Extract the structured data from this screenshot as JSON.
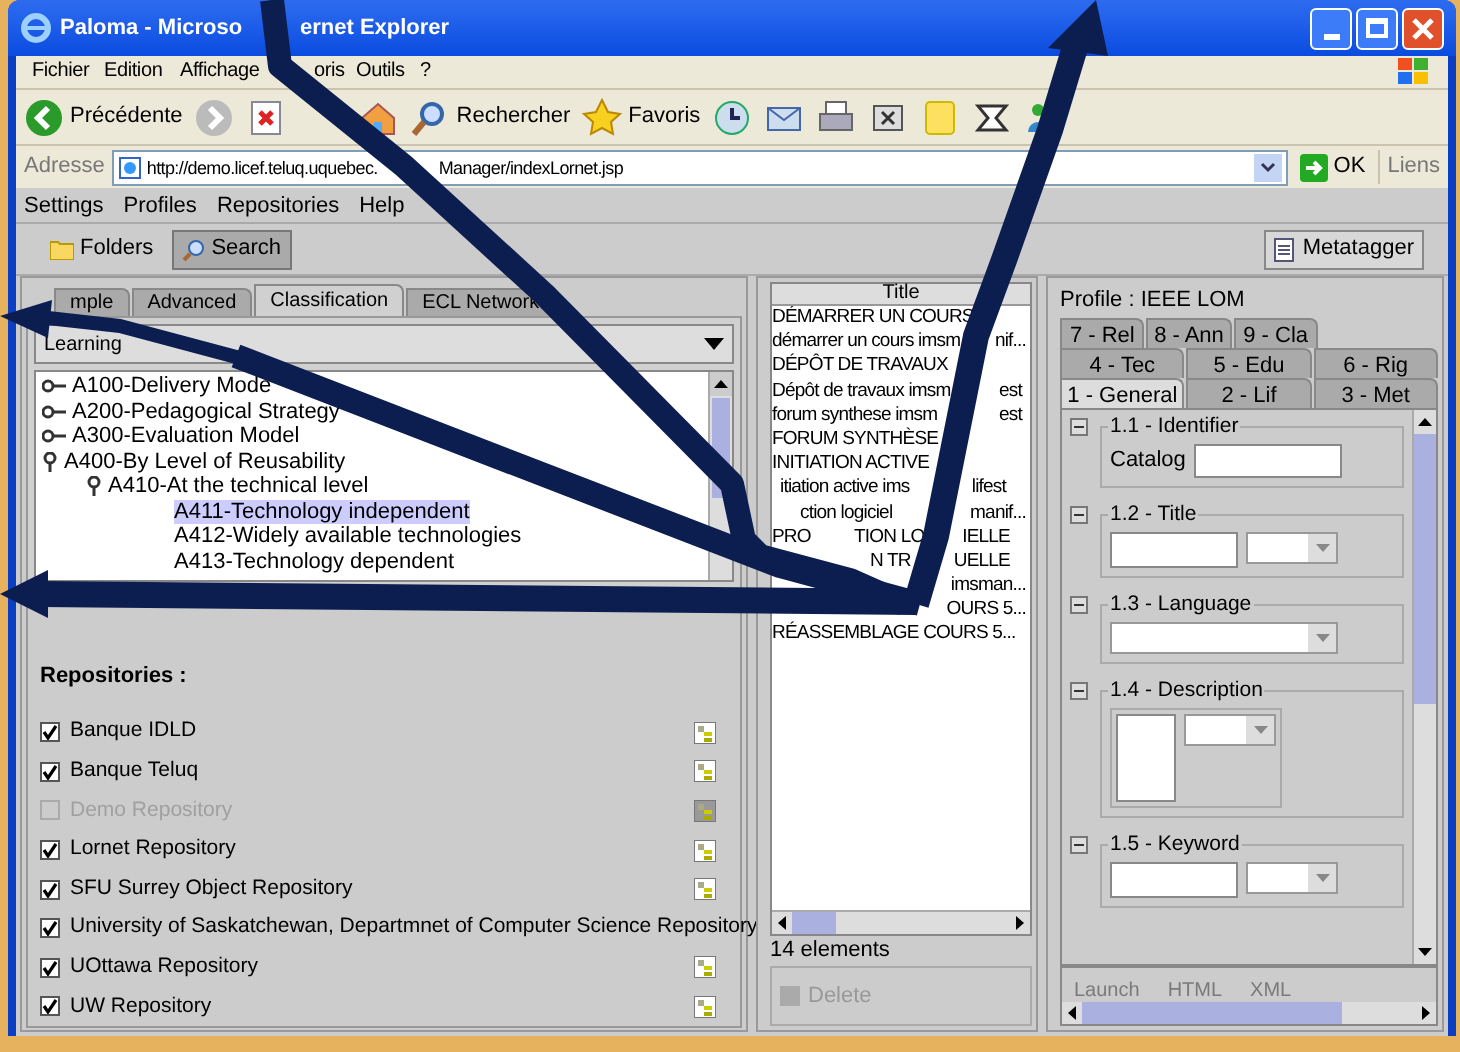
{
  "window": {
    "title_parts": [
      "Paloma - Microso",
      "ernet Explorer"
    ]
  },
  "ie_menu": [
    "Fichier",
    "Edition",
    "Affichage",
    "oris",
    "Outils",
    "?"
  ],
  "ie_toolbar": [
    {
      "kind": "back",
      "label": "Précédente"
    },
    {
      "kind": "forward"
    },
    {
      "kind": "stop"
    },
    {
      "kind": "home"
    },
    {
      "kind": "search",
      "label": "Rechercher"
    },
    {
      "kind": "favorites",
      "label": "Favoris"
    },
    {
      "kind": "history"
    },
    {
      "kind": "mail"
    },
    {
      "kind": "print"
    },
    {
      "kind": "edit"
    },
    {
      "kind": "note"
    },
    {
      "kind": "tool"
    },
    {
      "kind": "people"
    }
  ],
  "address": {
    "label": "Adresse",
    "url_parts": [
      "http://demo.licef.teluq.uquebec.",
      "Manager/indexLornet.jsp"
    ],
    "go": "OK",
    "links": "Liens"
  },
  "app_menu": [
    "Settings",
    "Profiles",
    "Repositories",
    "Help"
  ],
  "app_toolbar": [
    {
      "label": "Folders",
      "kind": "folder",
      "selected": false
    },
    {
      "label": "Search",
      "kind": "search",
      "selected": true
    }
  ],
  "metatagger": "Metatagger",
  "search_tabs": [
    {
      "label": "mple",
      "selected": false
    },
    {
      "label": "Advanced",
      "selected": false
    },
    {
      "label": "Classification",
      "selected": true
    },
    {
      "label": "ECL Network",
      "selected": false
    }
  ],
  "taxonomy_combo": "Learning",
  "tree": [
    {
      "label": "A100-Delivery Mode",
      "expanded": false,
      "selected": false
    },
    {
      "label": "A200-Pedagogical Strategy",
      "expanded": false,
      "selected": false
    },
    {
      "label": "A300-Evaluation Model",
      "expanded": false,
      "selected": false
    },
    {
      "label": "A400-By Level of Reusability",
      "expanded": true,
      "selected": false,
      "children": [
        {
          "label": "A410-At the technical level",
          "expanded": true,
          "selected": false,
          "children": [
            {
              "label": "A411-Technology independent",
              "selected": true
            },
            {
              "label": "A412-Widely available technologies",
              "selected": false
            },
            {
              "label": "A413-Technology dependent",
              "selected": false
            }
          ]
        }
      ]
    }
  ],
  "repositories": {
    "heading": "Repositories :",
    "items": [
      {
        "name": "Banque IDLD",
        "checked": true,
        "disabled": false,
        "browse": true
      },
      {
        "name": "Banque Teluq",
        "checked": true,
        "disabled": false,
        "browse": true
      },
      {
        "name": "Demo Repository",
        "checked": false,
        "disabled": true,
        "browse": true
      },
      {
        "name": "Lornet Repository",
        "checked": true,
        "disabled": false,
        "browse": true
      },
      {
        "name": "SFU Surrey Object Repository",
        "checked": true,
        "disabled": false,
        "browse": true
      },
      {
        "name": "University of Saskatchewan, Departmnet of Computer Science Repository",
        "checked": true,
        "disabled": false,
        "browse": false
      },
      {
        "name": "UOttawa Repository",
        "checked": true,
        "disabled": false,
        "browse": true
      },
      {
        "name": "UW Repository",
        "checked": true,
        "disabled": false,
        "browse": true
      }
    ]
  },
  "results": {
    "column": "Title",
    "rows": [
      {
        "fragments": [
          "DÉMARRER UN COURS"
        ]
      },
      {
        "fragments": [
          "démarrer un cours imsm",
          "nif..."
        ]
      },
      {
        "fragments": [
          "DÉPÔT DE TRAVAUX"
        ]
      },
      {
        "fragments": [
          "Dépôt de travaux imsm",
          "est"
        ]
      },
      {
        "fragments": [
          "forum synthese imsm",
          "est"
        ]
      },
      {
        "fragments": [
          "FORUM SYNTHÈSE"
        ]
      },
      {
        "fragments": [
          "INITIATION ACTIVE"
        ]
      },
      {
        "fragments": [
          "itiation active ims",
          "lifest"
        ]
      },
      {
        "fragments": [
          "ction logiciel",
          "manif..."
        ]
      },
      {
        "fragments": [
          "PRO",
          "TION LO",
          "IELLE"
        ]
      },
      {
        "fragments": [
          "N TR",
          "UELLE"
        ]
      },
      {
        "fragments": [
          "imsman..."
        ]
      },
      {
        "fragments": [
          "OURS 5..."
        ]
      },
      {
        "fragments": [
          "RÉASSEMBLAGE COURS 5..."
        ]
      }
    ],
    "count": "14 elements",
    "delete": "Delete"
  },
  "metadata": {
    "profile": "Profile : IEEE LOM",
    "tab_rows": [
      [
        {
          "label": "7 - Rel",
          "selected": false
        },
        {
          "label": "8 - Ann",
          "selected": false
        },
        {
          "label": "9 - Cla",
          "selected": false
        }
      ],
      [
        {
          "label": "4 - Tec",
          "selected": false
        },
        {
          "label": "5 - Edu",
          "selected": false
        },
        {
          "label": "6 - Rig",
          "selected": false
        }
      ],
      [
        {
          "label": "1 - General",
          "selected": true
        },
        {
          "label": "2 - Lif",
          "selected": false
        },
        {
          "label": "3 - Met",
          "selected": false
        }
      ]
    ],
    "sections": [
      {
        "title": "1.1 - Identifier",
        "kind": "catalog",
        "field_label": "Catalog"
      },
      {
        "title": "1.2 - Title",
        "kind": "text_lang"
      },
      {
        "title": "1.3 - Language",
        "kind": "combo"
      },
      {
        "title": "1.4 - Description",
        "kind": "area_lang"
      },
      {
        "title": "1.5 - Keyword",
        "kind": "text_lang"
      }
    ],
    "actions": [
      "Launch",
      "HTML",
      "XML"
    ]
  }
}
